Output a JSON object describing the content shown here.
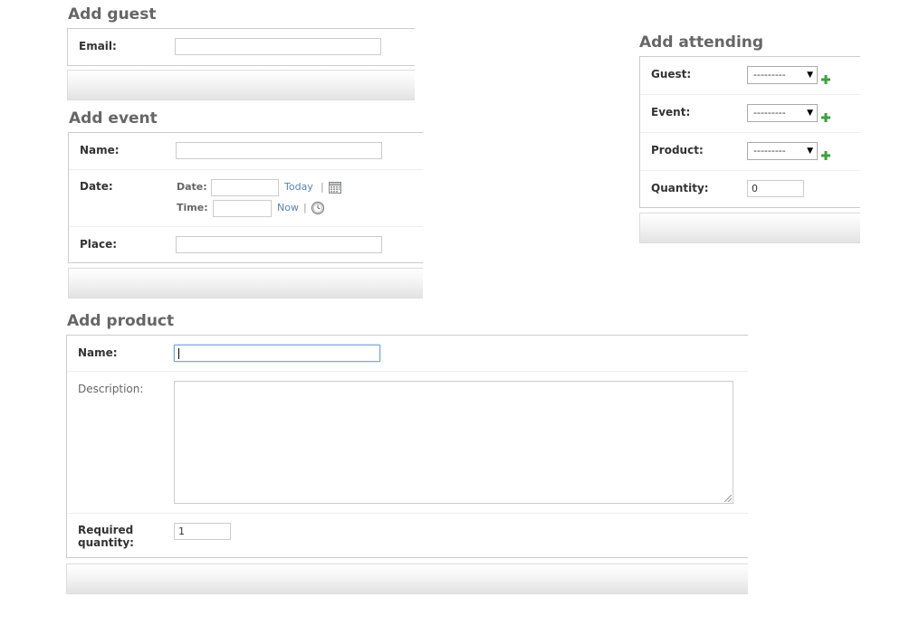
{
  "guest_form": {
    "title": "Add guest",
    "email_label": "Email:",
    "email_value": ""
  },
  "event_form": {
    "title": "Add event",
    "name_label": "Name:",
    "name_value": "",
    "date_label": "Date:",
    "date_sub_label": "Date:",
    "date_value": "",
    "today_link": "Today",
    "time_sub_label": "Time:",
    "time_value": "",
    "now_link": "Now",
    "separator": "|",
    "place_label": "Place:",
    "place_value": ""
  },
  "product_form": {
    "title": "Add product",
    "name_label": "Name:",
    "name_value": "",
    "description_label": "Description:",
    "description_value": "",
    "quantity_label_line1": "Required",
    "quantity_label_line2": "quantity:",
    "quantity_value": "1"
  },
  "attending_form": {
    "title": "Add attending",
    "guest_label": "Guest:",
    "guest_selected": "---------",
    "event_label": "Event:",
    "event_selected": "---------",
    "product_label": "Product:",
    "product_selected": "---------",
    "quantity_label": "Quantity:",
    "quantity_value": "0"
  },
  "icons": {
    "calendar": "calendar-icon",
    "clock": "clock-icon",
    "add": "add-plus-icon",
    "dropdown": "chevron-down-icon"
  },
  "colors": {
    "heading": "#666666",
    "link": "#5b80b2",
    "add_icon": "#3fa03f",
    "focus_border": "#7ea6d8"
  }
}
